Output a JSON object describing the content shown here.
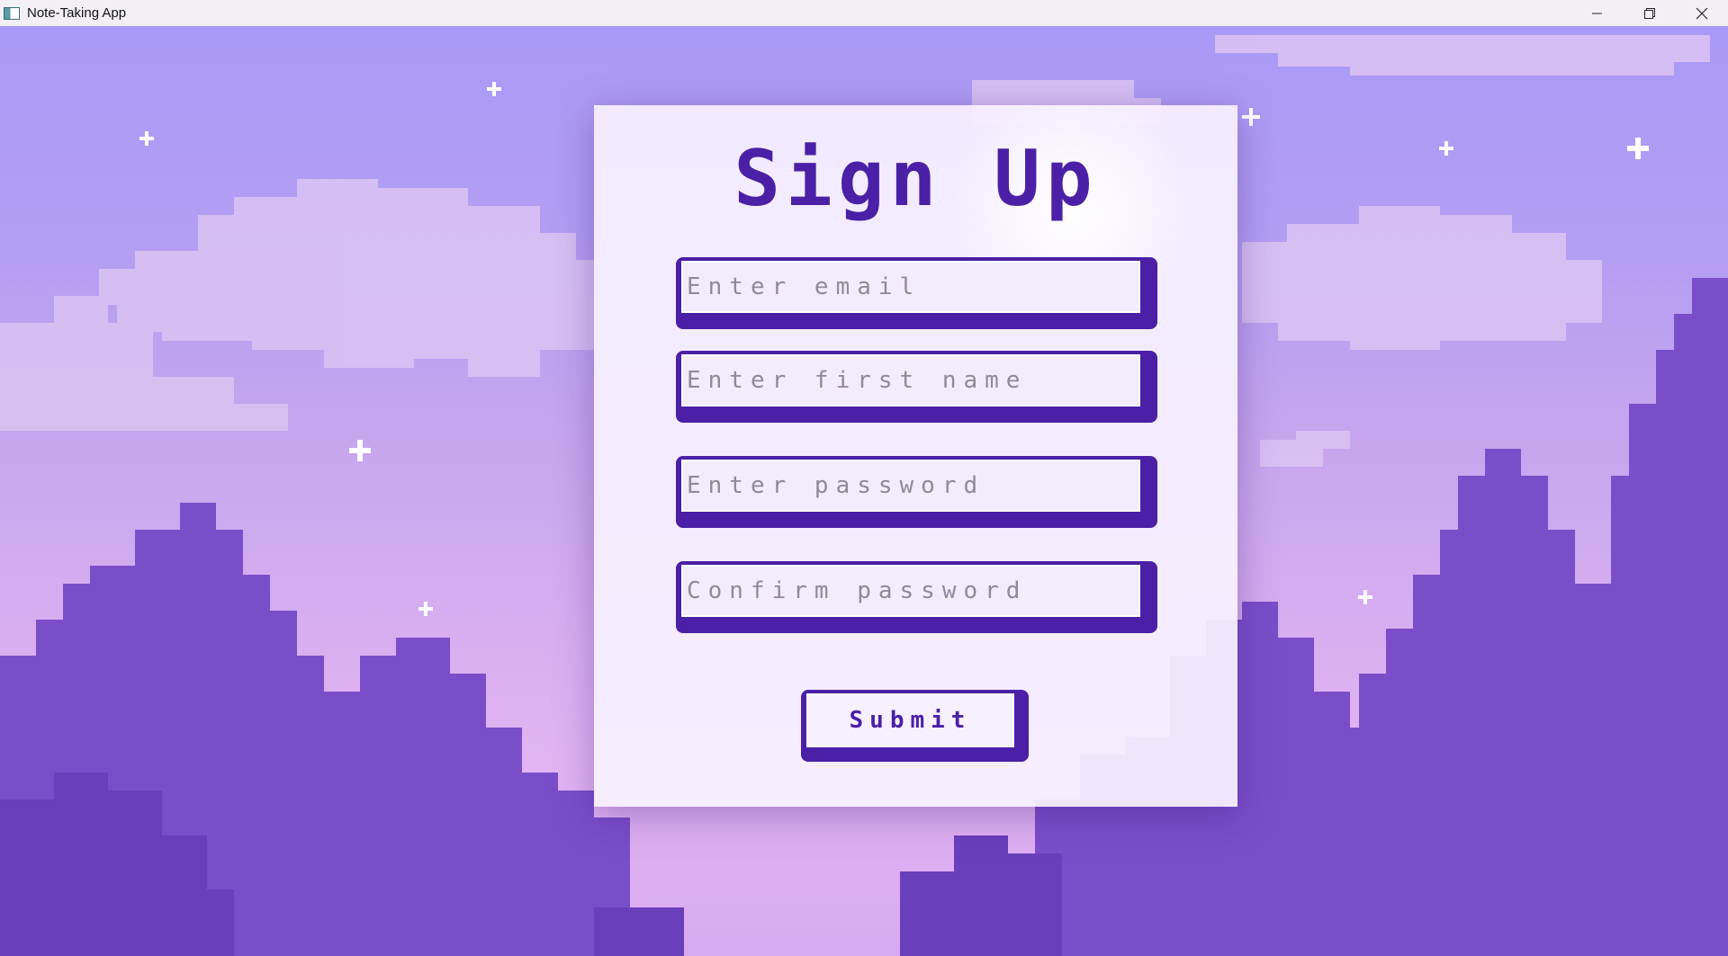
{
  "window": {
    "title": "Note-Taking App",
    "icons": [
      "app-icon",
      "minimize-icon",
      "restore-icon",
      "close-icon"
    ]
  },
  "signup": {
    "heading": "Sign Up",
    "email_placeholder": "Enter email",
    "first_name_placeholder": "Enter first name",
    "password_placeholder": "Enter password",
    "confirm_password_placeholder": "Confirm password",
    "submit_label": "Submit"
  },
  "colors": {
    "accent": "#4b1fa6",
    "card_bg": "#f6f0ff",
    "sky_top": "#a99af7",
    "sky_bottom": "#e2b4f3",
    "trees": "#6f45bf"
  }
}
